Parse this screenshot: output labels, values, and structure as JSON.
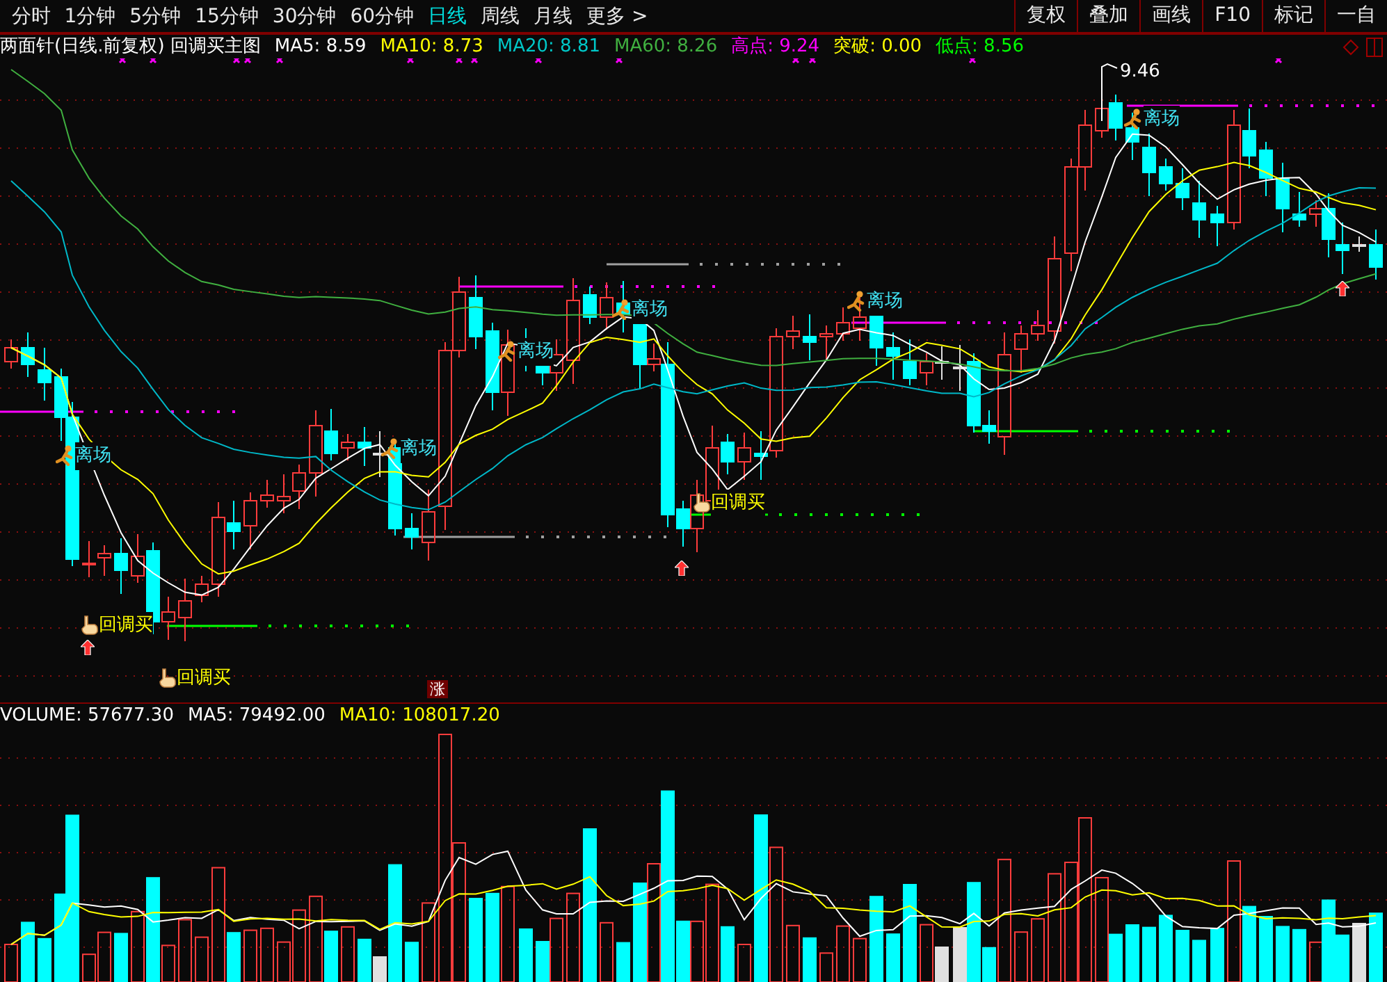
{
  "toolbar": {
    "tabs": [
      {
        "label": "分时",
        "selected": false
      },
      {
        "label": "1分钟",
        "selected": false
      },
      {
        "label": "5分钟",
        "selected": false
      },
      {
        "label": "15分钟",
        "selected": false
      },
      {
        "label": "30分钟",
        "selected": false
      },
      {
        "label": "60分钟",
        "selected": false
      },
      {
        "label": "日线",
        "selected": true
      },
      {
        "label": "周线",
        "selected": false
      },
      {
        "label": "月线",
        "selected": false
      },
      {
        "label": "更多 >",
        "selected": false
      }
    ],
    "buttons": [
      "复权",
      "叠加",
      "画线",
      "F10",
      "标记",
      "一自"
    ]
  },
  "main_chart": {
    "title": "两面针(日线.前复权) 回调买主图",
    "indicators": [
      {
        "text": "MA5: 8.59",
        "color": "#ffffff"
      },
      {
        "text": "MA10: 8.73",
        "color": "#ffff00"
      },
      {
        "text": "MA20: 8.81",
        "color": "#00c8c8"
      },
      {
        "text": "MA60: 8.26",
        "color": "#40b040"
      },
      {
        "text": "高点: 9.24",
        "color": "#ff00ff"
      },
      {
        "text": "突破: 0.00",
        "color": "#ffff00"
      },
      {
        "text": "低点: 8.56",
        "color": "#00ff00"
      }
    ],
    "high_label": "9.46",
    "signals": [
      {
        "kind": "exit",
        "label": "离场"
      },
      {
        "kind": "buy",
        "label": "回调买"
      },
      {
        "kind": "buy",
        "label": "回调买"
      },
      {
        "kind": "exit",
        "label": "离场"
      },
      {
        "kind": "exit",
        "label": "离场"
      },
      {
        "kind": "exit",
        "label": "离场"
      },
      {
        "kind": "buy",
        "label": "回调买"
      },
      {
        "kind": "exit",
        "label": "离场"
      },
      {
        "kind": "exit",
        "label": "离场"
      }
    ],
    "badge": "涨"
  },
  "volume_panel": {
    "indicators": [
      {
        "text": "VOLUME: 57677.30",
        "color": "#ffffff"
      },
      {
        "text": "MA5: 79492.00",
        "color": "#ffffff"
      },
      {
        "text": "MA10: 108017.20",
        "color": "#ffff00"
      }
    ]
  }
}
